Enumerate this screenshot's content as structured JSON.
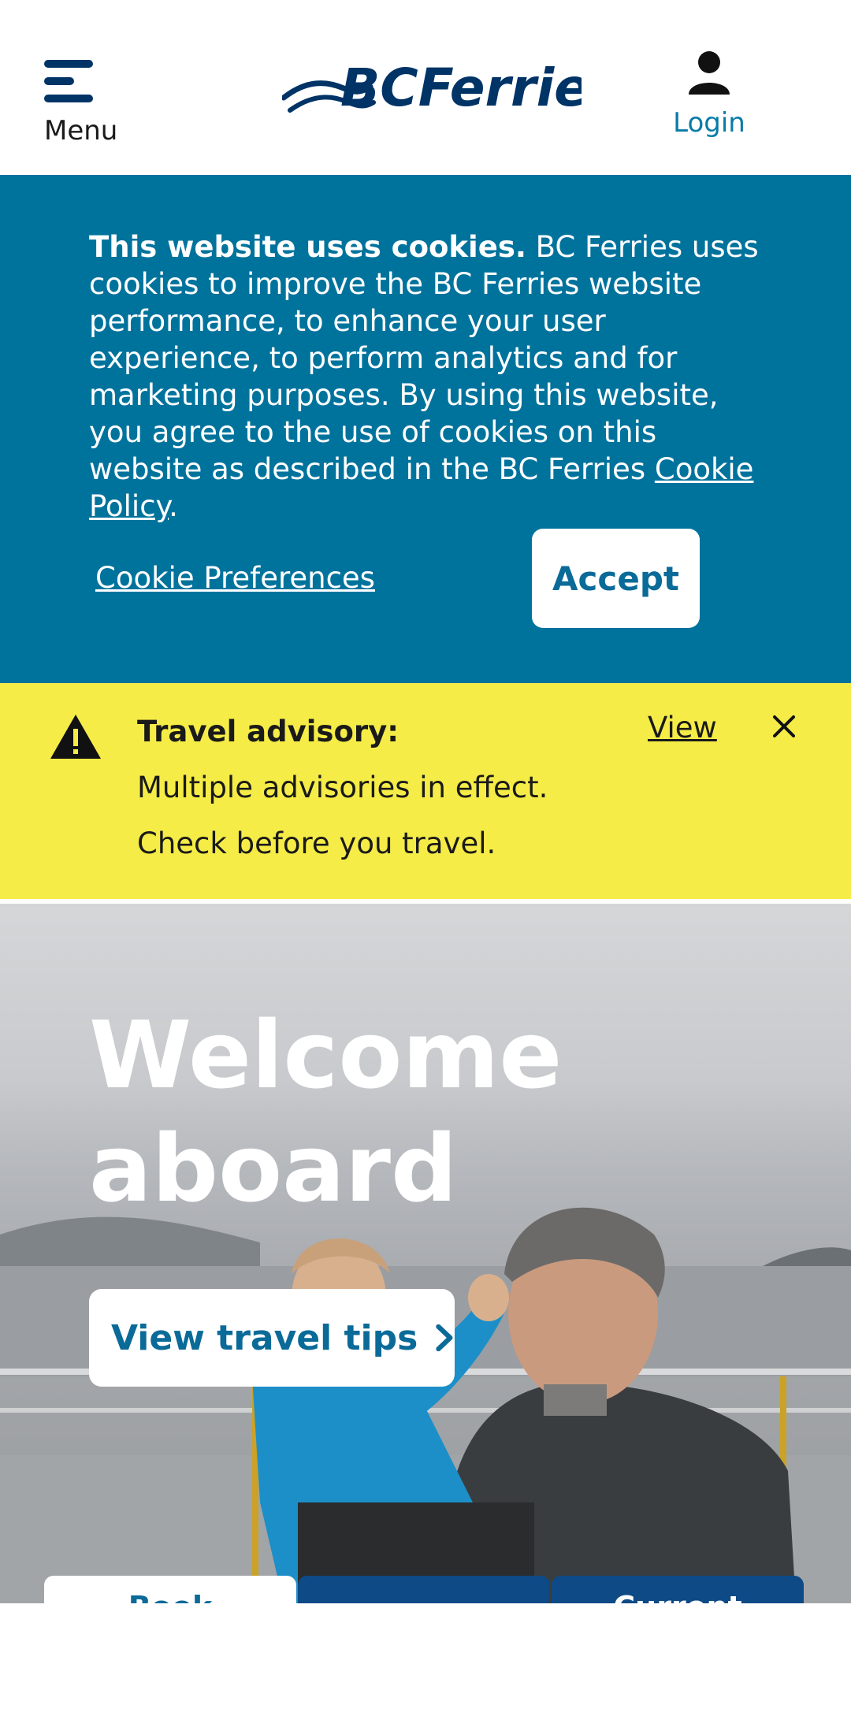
{
  "header": {
    "menu_label": "Menu",
    "menu_icon": "hamburger-icon",
    "logo_text": "BCFerries",
    "login_label": "Login",
    "login_icon": "user-icon"
  },
  "cookie_banner": {
    "bold_text": "This website uses cookies.",
    "body_text": " BC Ferries uses cookies to improve the BC Ferries website performance, to enhance your user experience, to perform analytics and for marketing purposes. By using this website, you agree to the use of cookies on this website as described in the BC Ferries ",
    "policy_link": "Cookie Policy",
    "trailing": ".",
    "preferences_link": "Cookie Preferences",
    "accept_label": "Accept"
  },
  "advisory": {
    "icon": "warning-icon",
    "title": "Travel advisory:",
    "line1": "Multiple advisories in effect.",
    "line2": "Check before you travel.",
    "view_label": "View",
    "close_icon": "close-icon"
  },
  "hero": {
    "title_line1": "Welcome",
    "title_line2": "aboard",
    "button_label": "View travel tips",
    "button_icon": "chevron-right-icon"
  },
  "tabs": [
    {
      "label": "Book"
    },
    {
      "label": ""
    },
    {
      "label": "Current"
    }
  ],
  "colors": {
    "brand_blue": "#003366",
    "link_blue": "#0a7ba7",
    "cookie_bg": "#00739d",
    "advisory_bg": "#f5ec47",
    "tab_navy": "#0d4a86"
  }
}
